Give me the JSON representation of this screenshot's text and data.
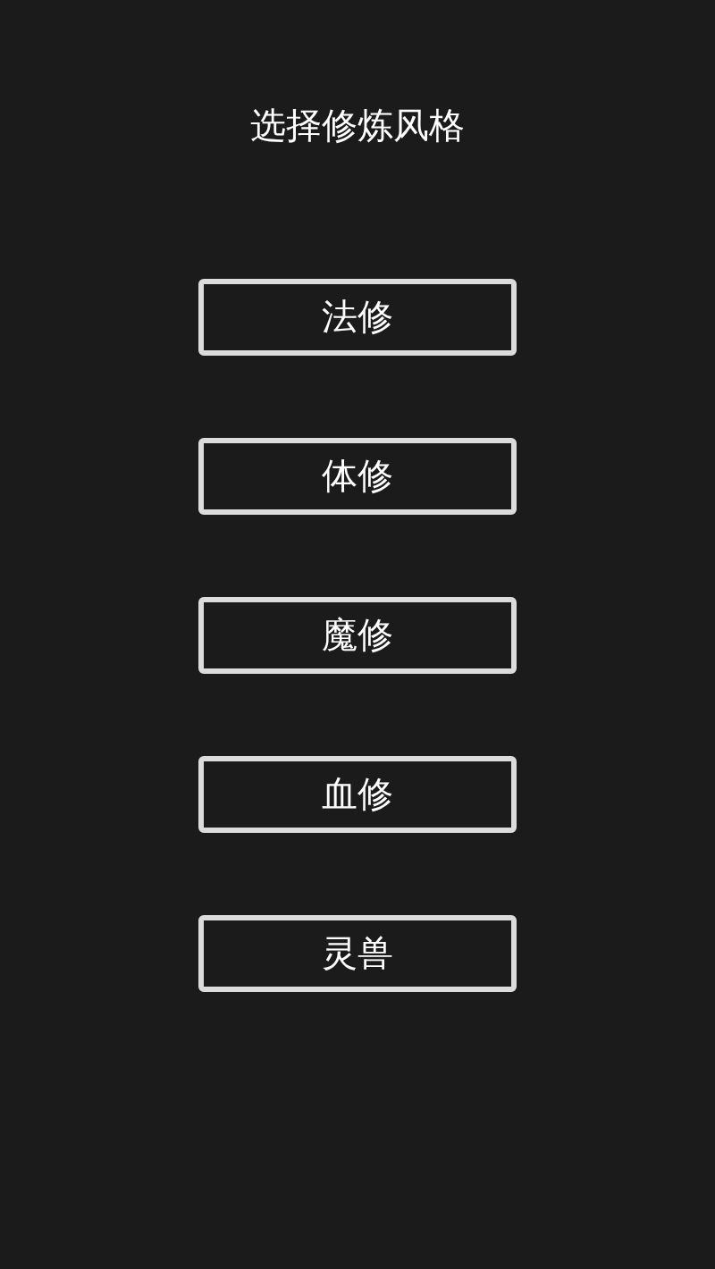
{
  "title": "选择修炼风格",
  "options": [
    {
      "label": "法修"
    },
    {
      "label": "体修"
    },
    {
      "label": "魔修"
    },
    {
      "label": "血修"
    },
    {
      "label": "灵兽"
    }
  ]
}
